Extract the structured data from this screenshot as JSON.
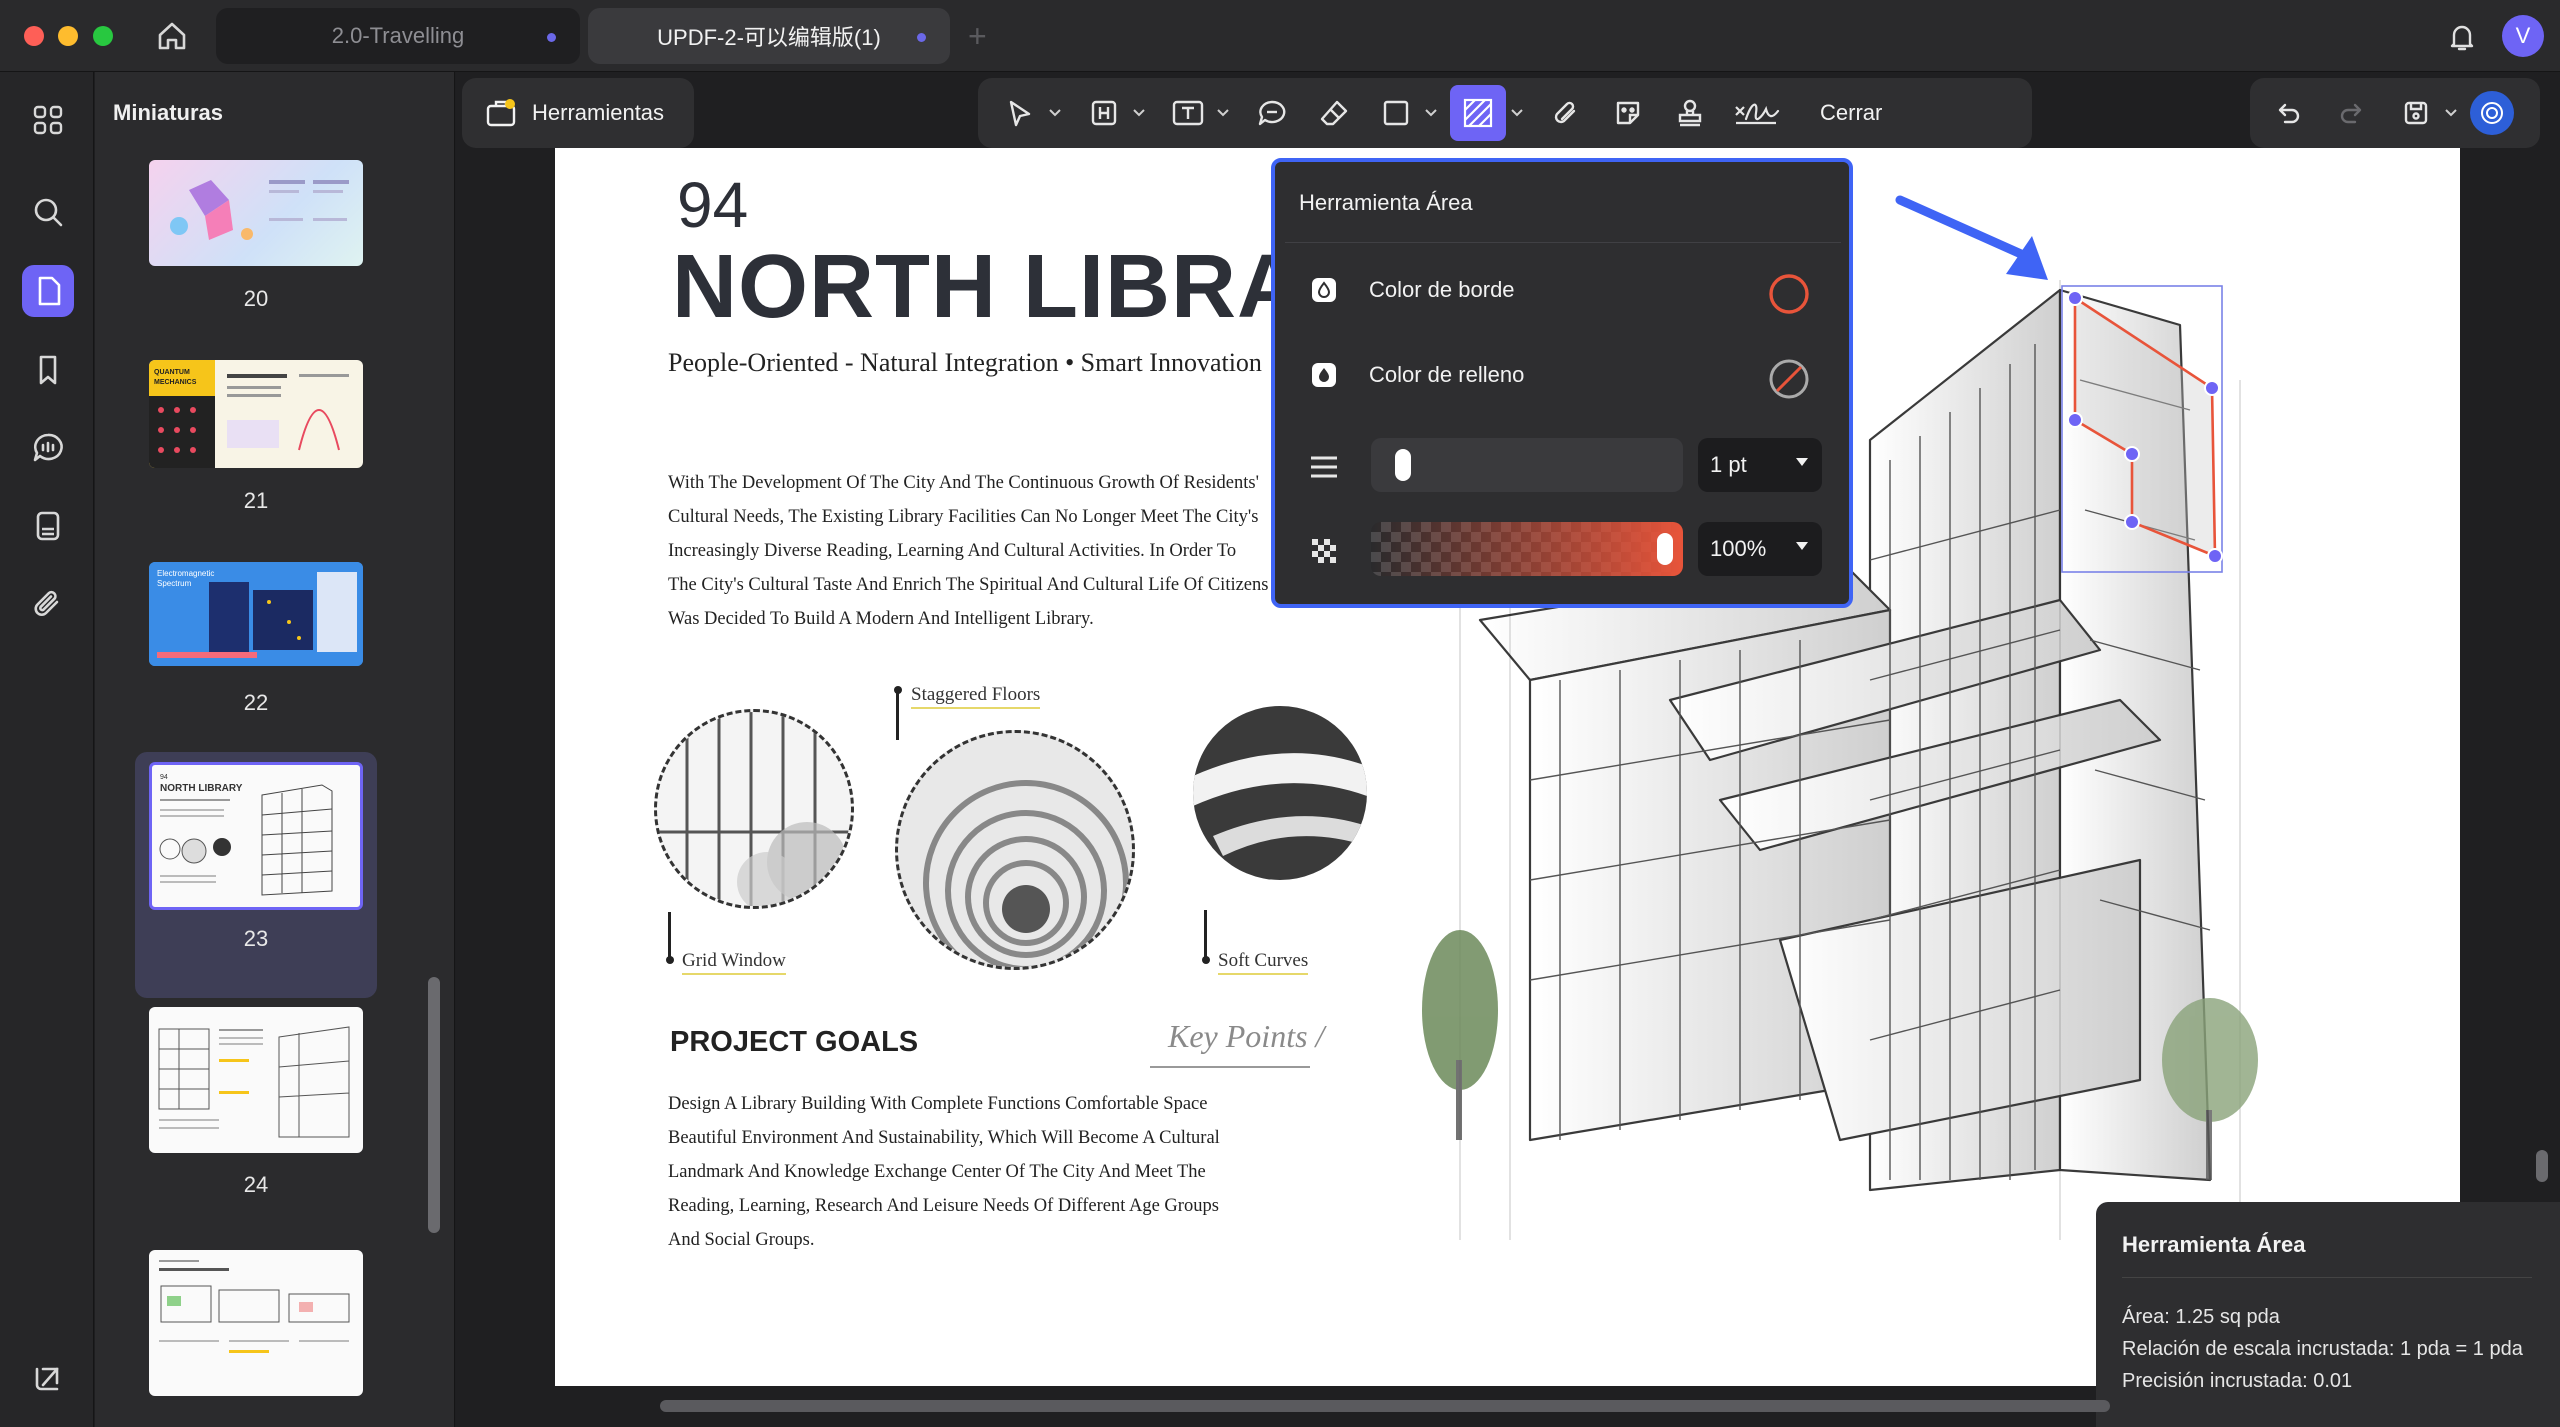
{
  "window": {
    "tabs": [
      {
        "label": "2.0-Travelling"
      },
      {
        "label": "UPDF-2-可以编辑版(1)"
      }
    ],
    "tab_add": "+",
    "avatar_initial": "V"
  },
  "sidebar": {
    "title": "Miniaturas",
    "pages": [
      {
        "number": "20"
      },
      {
        "number": "21"
      },
      {
        "number": "22"
      },
      {
        "number": "23"
      },
      {
        "number": "24"
      },
      {
        "number": ""
      }
    ],
    "thumb_labels": {
      "p21": "QUANTUM MECHANICS",
      "p22": "Electromagnetic Spectrum",
      "p23_num": "94",
      "p23_title": "NORTH LIBRARY"
    }
  },
  "toolbar": {
    "tools_label": "Herramientas",
    "close_label": "Cerrar",
    "icons": [
      "cursor-icon",
      "highlight-icon",
      "text-box-icon",
      "comment-icon",
      "eraser-icon",
      "rectangle-icon",
      "area-tool-icon",
      "attachment-icon",
      "sticker-icon",
      "stamp-icon",
      "signature-icon"
    ]
  },
  "document": {
    "page_number": "94",
    "title": "NORTH LIBRARY",
    "subtitle": "People-Oriented - Natural Integration • Smart Innovation",
    "body_lines": [
      "With The Development Of The City And The Continuous Growth Of Residents'",
      "Cultural Needs, The Existing Library Facilities Can No Longer Meet The City's",
      "Increasingly Diverse Reading, Learning And Cultural Activities. In Order To",
      "The City's Cultural Taste And Enrich The Spiritual And Cultural Life Of Citizens,",
      "Was Decided To Build A Modern And Intelligent Library."
    ],
    "captions": {
      "grid": "Grid Window",
      "staggered": "Staggered Floors",
      "soft": "Soft Curves"
    },
    "goals_title": "PROJECT GOALS",
    "key_points": "Key Points /",
    "goals_lines": [
      "Design A Library Building With Complete Functions Comfortable Space",
      "Beautiful Environment And Sustainability, Which Will Become A Cultural",
      "Landmark And Knowledge Exchange Center Of The City And Meet The",
      "Reading, Learning, Research And Leisure Needs Of Different Age Groups",
      "And Social Groups."
    ]
  },
  "area_popup": {
    "title": "Herramienta Área",
    "border_color_label": "Color de borde",
    "fill_color_label": "Color de relleno",
    "border_color": "#e8543a",
    "stroke_width": "1 pt",
    "stroke_level": 0.05,
    "opacity": "100%",
    "opacity_level": 1.0
  },
  "info_panel": {
    "title": "Herramienta Área",
    "area": "Área: 1.25 sq pda",
    "scale": "Relación de escala incrustada: 1 pda = 1 pda",
    "precision": "Precisión incrustada: 0.01"
  },
  "colors": {
    "accent": "#6e64f5",
    "popup_border": "#3f64f5",
    "measure_stroke": "#e8543a"
  }
}
